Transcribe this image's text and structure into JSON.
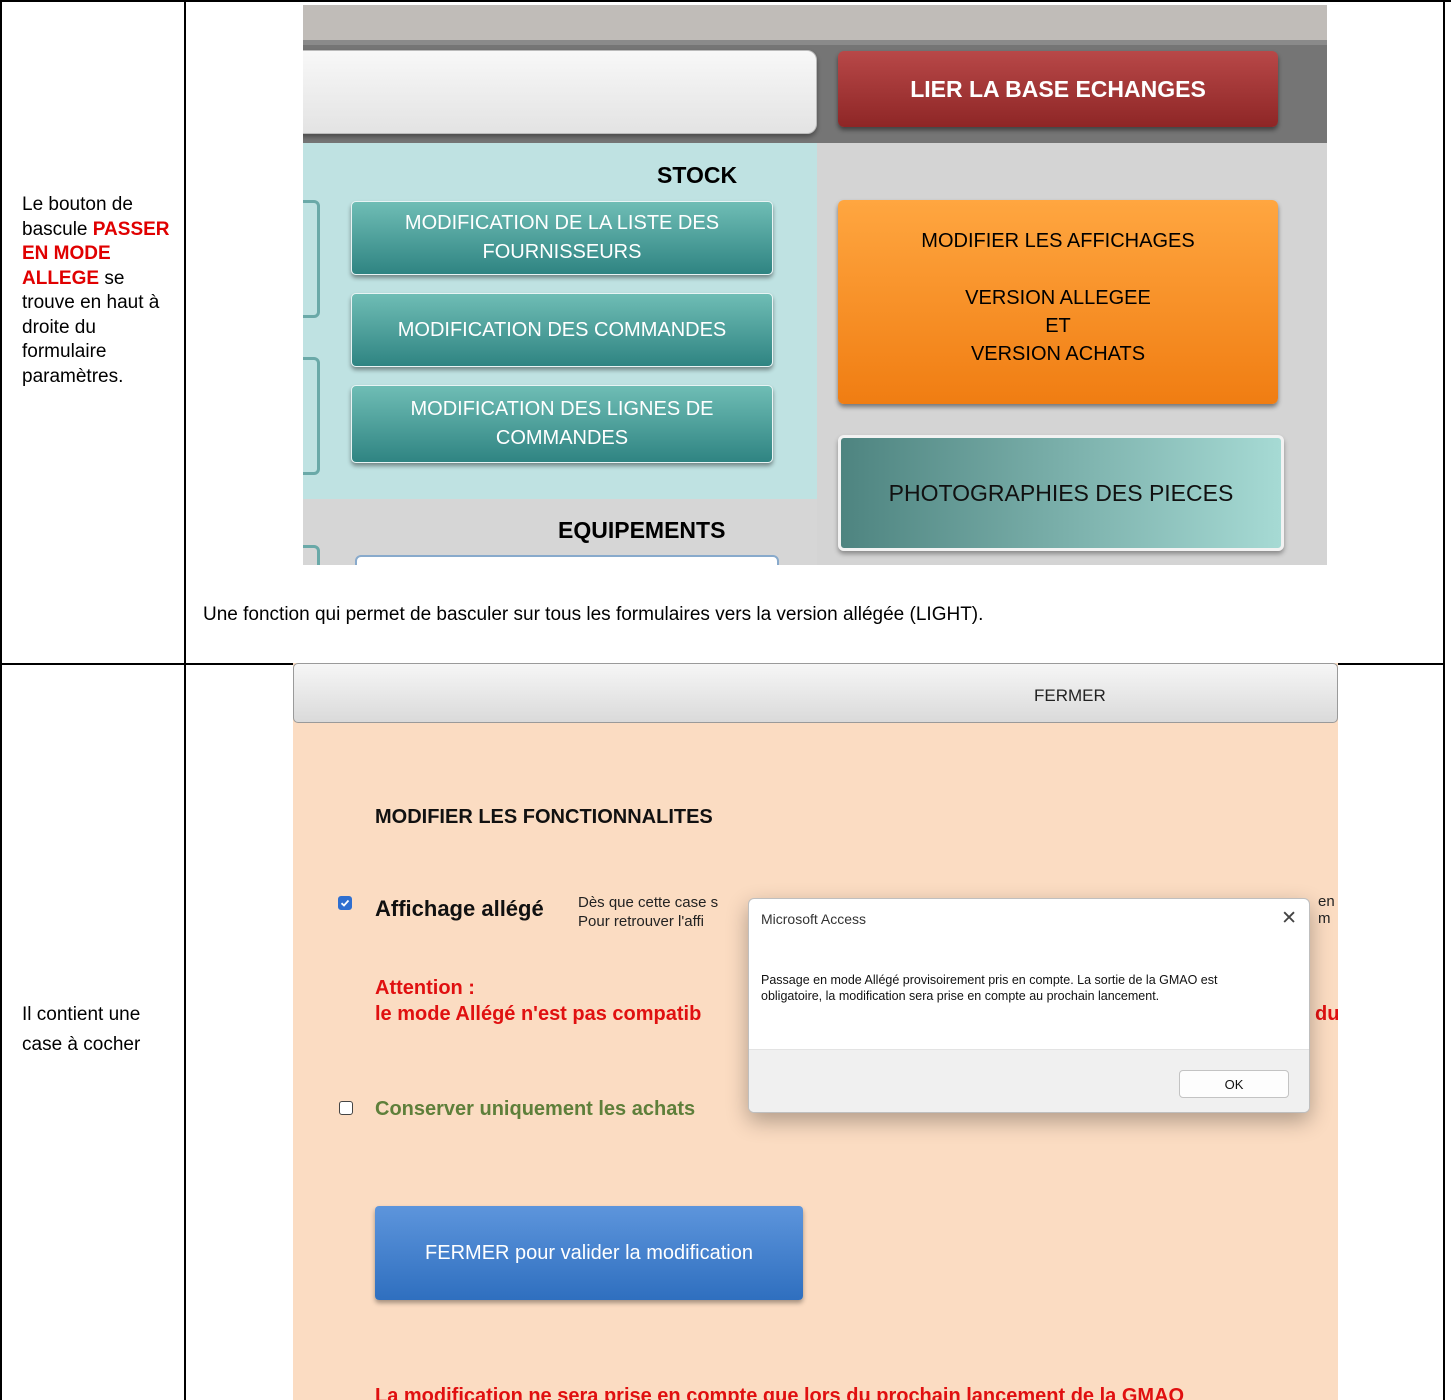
{
  "row1": {
    "left": {
      "text_before": "Le bouton de bascule",
      "highlight": "PASSER EN MODE ALLEGE",
      "text_after": "se trouve en haut à droite du formulaire paramètres."
    },
    "caption": "Une fonction qui permet de basculer sur tous les formulaires vers la version allégée (LIGHT).",
    "screenshot": {
      "link_button": "LIER LA BASE  ECHANGES",
      "stock_heading": "STOCK",
      "buttons": [
        {
          "line1": "MODIFICATION DE LA LISTE DES",
          "line2": "FOURNISSEURS"
        },
        {
          "line1": "MODIFICATION DES COMMANDES",
          "line2": ""
        },
        {
          "line1": "MODIFICATION DES LIGNES DE",
          "line2": "COMMANDES"
        }
      ],
      "equipements_heading": "EQUIPEMENTS",
      "orange_button": {
        "line1": "MODIFIER LES AFFICHAGES",
        "line2": "VERSION ALLEGEE",
        "line3": "ET",
        "line4": "VERSION ACHATS"
      },
      "photo_button": "PHOTOGRAPHIES DES PIECES"
    }
  },
  "row2": {
    "left": {
      "text": "Il contient une case à cocher"
    },
    "screenshot": {
      "top_button": "FERMER",
      "section_title": "MODIFIER LES FONCTIONNALITES",
      "checkbox_affichage": {
        "label": "Affichage allégé",
        "checked": true
      },
      "description_line1": "Dès que cette case s",
      "description_line2": "Pour retrouver l'affi",
      "description_tail": "en m",
      "attention_title": "Attention :",
      "attention_text": "le mode Allégé n'est pas compatib",
      "attention_tail": "du",
      "checkbox_achats": {
        "label": "Conserver uniquement les achats",
        "checked": false
      },
      "validate_button": "FERMER pour valider la modification",
      "bottom_note": "La modification ne sera prise en compte que lors du prochain lancement de la GMAO",
      "dialog": {
        "title": "Microsoft Access",
        "close_icon": "close-icon",
        "message": "Passage en mode Allégé provisoirement pris en compte. La sortie de la GMAO est obligatoire, la modification sera prise en compte au prochain lancement.",
        "ok_label": "OK"
      }
    }
  }
}
